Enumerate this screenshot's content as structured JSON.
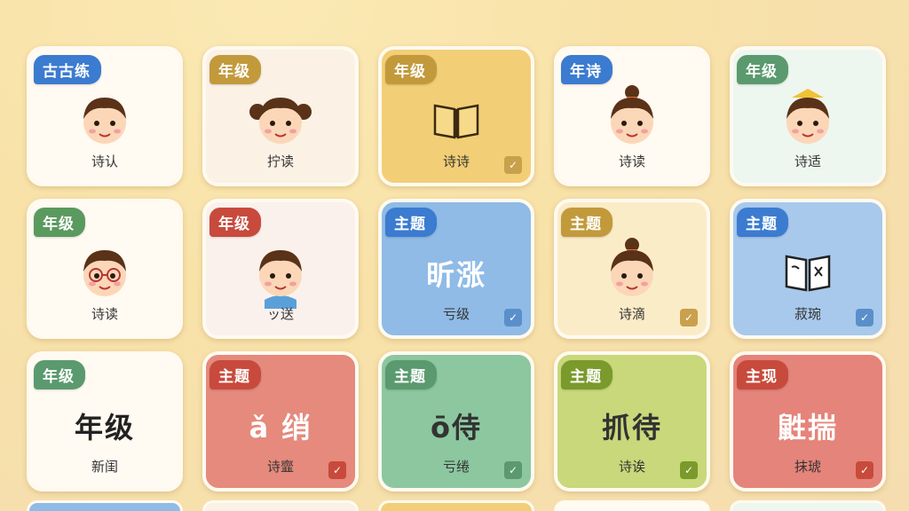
{
  "cards": [
    {
      "tag": "古古练",
      "caption": "诗认",
      "tag_color": "#3b7bd0",
      "bg": "#fffaf2",
      "art": "boy"
    },
    {
      "tag": "年级",
      "caption": "拧读",
      "tag_color": "#c29a3c",
      "bg": "#fbf1e5",
      "art": "girl-pigtails"
    },
    {
      "tag": "年级",
      "caption": "诗诗",
      "tag_color": "#c29a3c",
      "bg": "#f2cf76",
      "art": "book",
      "check": true,
      "check_color": "#c9a04b"
    },
    {
      "tag": "年诗",
      "caption": "诗读",
      "tag_color": "#3b7bd0",
      "bg": "#fffaf2",
      "art": "girl-bun"
    },
    {
      "tag": "年级",
      "caption": "诗适",
      "tag_color": "#5a9a6e",
      "bg": "#eef6f0",
      "art": "boy-cap"
    },
    {
      "tag": "年级",
      "caption": "诗读",
      "tag_color": "#5a9a5e",
      "bg": "#fffaf2",
      "art": "boy-glasses"
    },
    {
      "tag": "年级",
      "caption": "ッ送",
      "tag_color": "#c84a3c",
      "bg": "#fbf1ec",
      "art": "boy-blue"
    },
    {
      "tag": "主题",
      "caption": "亏级",
      "tag_color": "#3b7bd0",
      "bg": "#8fbbe6",
      "big": "昕涨",
      "big_color": "#ffffff",
      "check": true,
      "check_color": "#5a8fca"
    },
    {
      "tag": "主题",
      "caption": "诗滴",
      "tag_color": "#c29a3c",
      "bg": "#fbecc8",
      "art": "girl-bun2",
      "check": true,
      "check_color": "#c9a04b"
    },
    {
      "tag": "主题",
      "caption": "菽琬",
      "tag_color": "#3b7bd0",
      "bg": "#a8c9ec",
      "art": "open-book",
      "check": true,
      "check_color": "#5a8fca"
    },
    {
      "tag": "年级",
      "caption": "新闺",
      "tag_color": "#5a9a6e",
      "bg": "#fffaf2",
      "big": "年级",
      "big_color": "#222222"
    },
    {
      "tag": "主题",
      "caption": "诗韲",
      "tag_color": "#c84a3c",
      "bg": "#e58a7c",
      "big": "ǎ 绡",
      "big_color": "#ffffff",
      "check": true,
      "check_color": "#c84a3c"
    },
    {
      "tag": "主题",
      "caption": "亏绻",
      "tag_color": "#5a9a6e",
      "bg": "#8cc7a0",
      "big": "ō侍",
      "big_color": "#333333",
      "check": true,
      "check_color": "#5a9a6e"
    },
    {
      "tag": "主题",
      "caption": "诗诶",
      "tag_color": "#7a9a2c",
      "bg": "#c8d87a",
      "big": "抓待",
      "big_color": "#333333",
      "check": true,
      "check_color": "#7a9a2c"
    },
    {
      "tag": "主现",
      "caption": "抹琥",
      "tag_color": "#c84a3c",
      "bg": "#e5847a",
      "big": "鼪揣",
      "big_color": "#ffffff",
      "check": true,
      "check_color": "#c84a3c"
    }
  ],
  "strip_colors": [
    "#8fbbe6",
    "#fbf1e5",
    "#f2cf76",
    "#fffaf2",
    "#eef6f0"
  ]
}
